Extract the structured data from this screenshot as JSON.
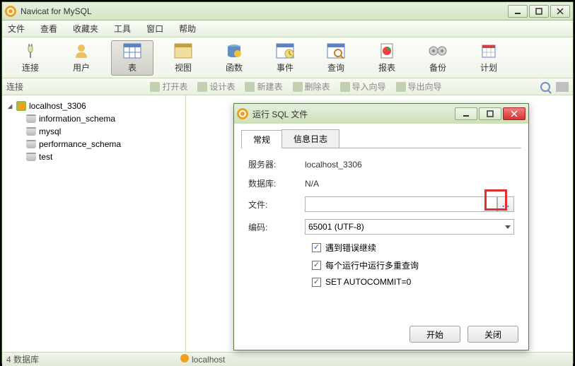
{
  "app": {
    "title": "Navicat for MySQL"
  },
  "menu": {
    "items": [
      "文件",
      "查看",
      "收藏夹",
      "工具",
      "窗口",
      "帮助"
    ]
  },
  "toolbar": {
    "items": [
      {
        "label": "连接"
      },
      {
        "label": "用户"
      },
      {
        "label": "表"
      },
      {
        "label": "视图"
      },
      {
        "label": "函数"
      },
      {
        "label": "事件"
      },
      {
        "label": "查询"
      },
      {
        "label": "报表"
      },
      {
        "label": "备份"
      },
      {
        "label": "计划"
      }
    ]
  },
  "subtoolbar": {
    "label": "连接",
    "items": [
      "打开表",
      "设计表",
      "新建表",
      "删除表",
      "导入向导",
      "导出向导"
    ]
  },
  "tree": {
    "conn": "localhost_3306",
    "dbs": [
      "information_schema",
      "mysql",
      "performance_schema",
      "test"
    ]
  },
  "status": {
    "left": "4 数据库",
    "right": "localhost"
  },
  "dialog": {
    "title": "运行 SQL 文件",
    "tabs": [
      "常规",
      "信息日志"
    ],
    "server_label": "服务器:",
    "server_value": "localhost_3306",
    "db_label": "数据库:",
    "db_value": "N/A",
    "file_label": "文件:",
    "file_value": "",
    "browse": "...",
    "enc_label": "编码:",
    "enc_value": "65001 (UTF-8)",
    "chk1": "遇到错误继续",
    "chk2": "每个运行中运行多重查询",
    "chk3": "SET AUTOCOMMIT=0",
    "start": "开始",
    "close": "关闭"
  }
}
